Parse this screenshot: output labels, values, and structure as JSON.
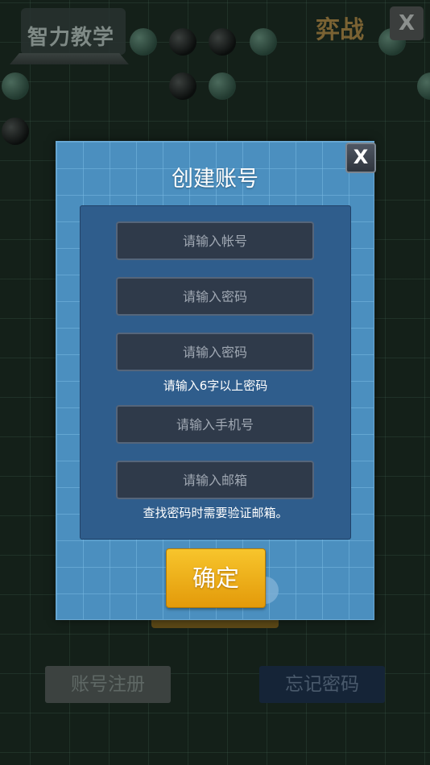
{
  "background": {
    "logo_text": "智力教学",
    "title": "弈战",
    "close_label": "X",
    "register_button": "账号注册",
    "forgot_button": "忘记密码"
  },
  "modal": {
    "title": "创建账号",
    "close_label": "X",
    "account_placeholder": "请输入帐号",
    "password_placeholder": "请输入密码",
    "password_confirm_placeholder": "请输入密码",
    "password_hint": "请输入6字以上密码",
    "phone_placeholder": "请输入手机号",
    "email_placeholder": "请输入邮箱",
    "email_hint": "查找密码时需要验证邮箱。",
    "confirm_label": "确定"
  },
  "colors": {
    "modal_bg": "#4b8fbf",
    "panel_bg": "#2f5d8c",
    "confirm_gold": "#f0b01b"
  }
}
